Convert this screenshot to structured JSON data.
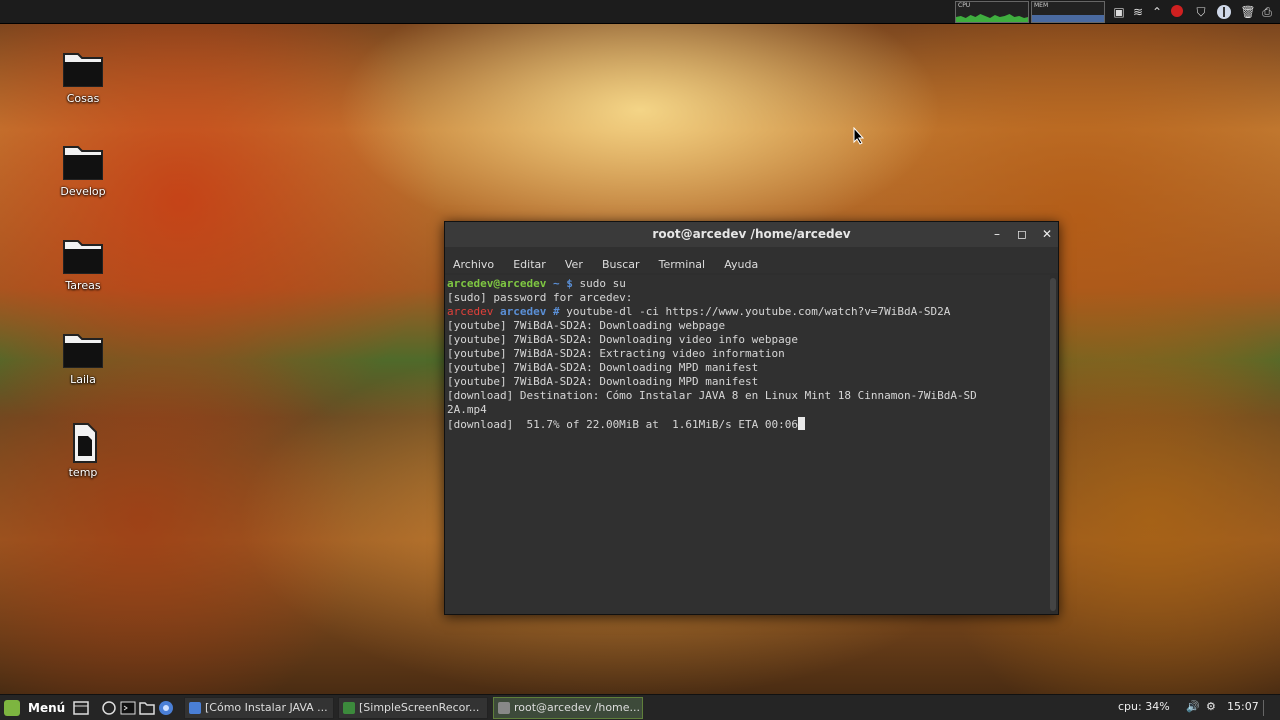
{
  "top_panel": {
    "cpu_label": "CPU",
    "mem_label": "MEM",
    "tray_icons": [
      "window-list-icon",
      "wifi-icon",
      "chevron-up-icon",
      "record-icon",
      "shield-icon",
      "network-icon",
      "trash-icon",
      "screenshot-icon"
    ]
  },
  "desktop": {
    "icons": [
      {
        "label": "Cosas",
        "icon": "folder-icon"
      },
      {
        "label": "Develop",
        "icon": "folder-icon"
      },
      {
        "label": "Tareas",
        "icon": "folder-icon"
      },
      {
        "label": "Laila",
        "icon": "folder-icon"
      },
      {
        "label": "temp",
        "icon": "file-icon"
      }
    ]
  },
  "terminal": {
    "title": "root@arcedev /home/arcedev",
    "menu": [
      "Archivo",
      "Editar",
      "Ver",
      "Buscar",
      "Terminal",
      "Ayuda"
    ],
    "lines": {
      "l1_prompt": "arcedev@arcedev",
      "l1_sep": " ~ $ ",
      "l1_cmd": "sudo su",
      "l2": "[sudo] password for arcedev:",
      "l3_host": "arcedev",
      "l3_dir": " arcedev # ",
      "l3_cmd": "youtube-dl -ci https://www.youtube.com/watch?v=7WiBdA-SD2A",
      "l4": "[youtube] 7WiBdA-SD2A: Downloading webpage",
      "l5": "[youtube] 7WiBdA-SD2A: Downloading video info webpage",
      "l6": "[youtube] 7WiBdA-SD2A: Extracting video information",
      "l7": "[youtube] 7WiBdA-SD2A: Downloading MPD manifest",
      "l8": "[youtube] 7WiBdA-SD2A: Downloading MPD manifest",
      "l9": "[download] Destination: Cómo Instalar JAVA 8 en Linux Mint 18 Cinnamon-7WiBdA-SD",
      "l10": "2A.mp4",
      "l11": "[download]  51.7% of 22.00MiB at  1.61MiB/s ETA 00:06"
    }
  },
  "taskbar": {
    "menu_label": "Menú",
    "launchers": [
      "files-icon",
      "updates-icon",
      "terminal-icon",
      "folder-icon",
      "browser-icon"
    ],
    "tasks": [
      {
        "label": "[Cómo Instalar JAVA ...",
        "icon": "chromium-icon",
        "color": "#4a7fd6"
      },
      {
        "label": "[SimpleScreenRecor...",
        "icon": "recorder-icon",
        "color": "#3c8a3c"
      },
      {
        "label": "root@arcedev /home...",
        "icon": "terminal-icon",
        "color": "#888888"
      }
    ],
    "cpu": "cpu: 34%",
    "clock": "15:07"
  },
  "colors": {
    "prompt_green": "#7fc742",
    "root_red": "#e0403a",
    "dir_blue": "#5a8fd6"
  }
}
